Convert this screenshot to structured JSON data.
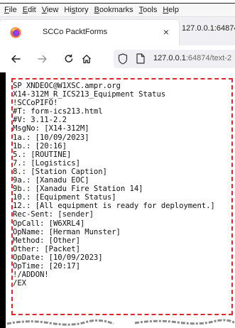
{
  "menu": {
    "items": [
      {
        "key": "F",
        "rest": "ile"
      },
      {
        "key": "E",
        "rest": "dit"
      },
      {
        "key": "V",
        "rest": "iew"
      },
      {
        "key": "",
        "rest": "Hi",
        "key2": "s",
        "rest2": "tory"
      },
      {
        "key": "B",
        "rest": "ookmarks"
      },
      {
        "key": "T",
        "rest": "ools"
      },
      {
        "key": "H",
        "rest": "elp"
      }
    ]
  },
  "tabs": {
    "active_label": "SCCo PacktForms",
    "close_glyph": "×",
    "second_label": "127.0.0.1:64874/t"
  },
  "navigation": {
    "url_host": "127.0.0.1",
    "url_path": ":64874/text-2"
  },
  "message": {
    "lines": [
      "SP XNDEOC@W1XSC.ampr.org",
      "X14-312M_R_ICS213_Equipment Status",
      "!SCCoPIFO!",
      "#T: form-ics213.html",
      "#V: 3.11-2.2",
      "MsgNo: [X14-312M]",
      "1a.: [10/09/2023]",
      "1b.: [20:16]",
      "5.: [ROUTINE]",
      "7.: [Logistics]",
      "8.: [Station Caption]",
      "9a.: [Xanadu EOC]",
      "9b.: [Xanadu Fire Station 14]",
      "10.: [Equipment Status]",
      "12.: [All equipment is ready for deployment.]",
      "Rec-Sent: [sender]",
      "OpCall: [W6XRL4]",
      "OpName: [Herman Munster]",
      "Method: [Other]",
      "Other: [Packet]",
      "OpDate: [10/09/2023]",
      "OpTime: [20:17]",
      "!/ADDON!",
      "/EX"
    ]
  },
  "colors": {
    "highlight_border": "#e0262b",
    "firefox_orange": "#ff7139",
    "firefox_purple": "#7542e5"
  }
}
